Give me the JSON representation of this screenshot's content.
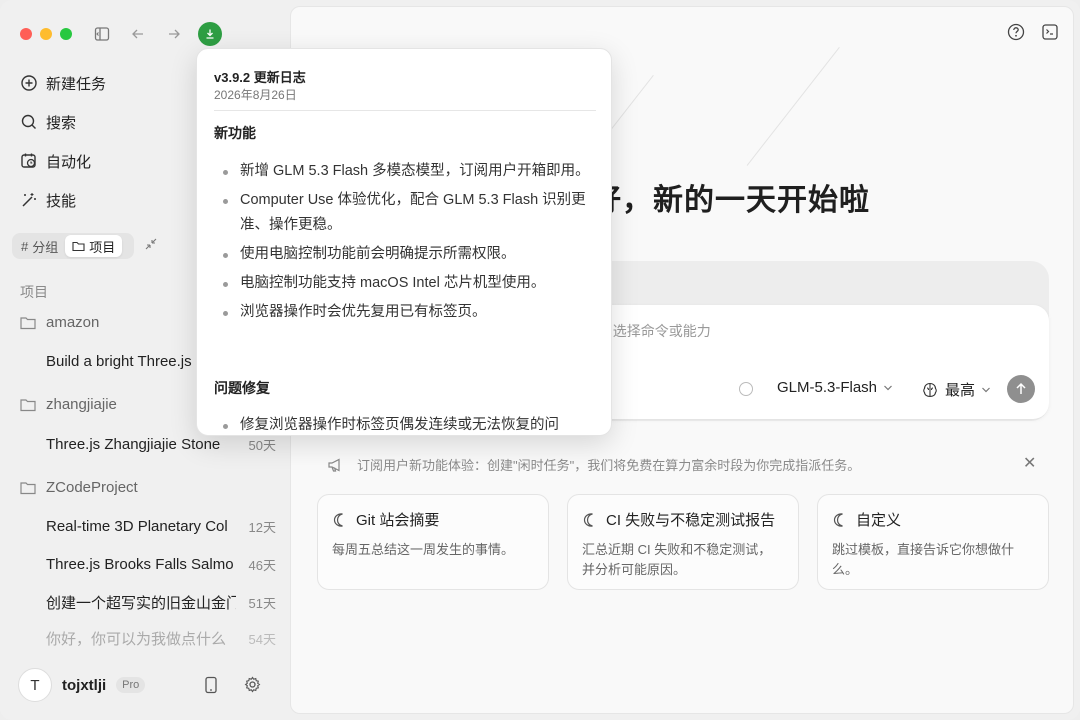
{
  "sidebar": {
    "nav": {
      "new_task": "新建任务",
      "search": "搜索",
      "automation": "自动化",
      "skills": "技能"
    },
    "segment": {
      "group": "分组",
      "project": "项目"
    },
    "section_label": "项目",
    "folders": [
      {
        "name": "amazon",
        "tasks": [
          {
            "title": "Build a bright Three.js",
            "days": ""
          }
        ]
      },
      {
        "name": "zhangjiajie",
        "tasks": [
          {
            "title": "Three.js Zhangjiajie Stone",
            "days": "50天"
          }
        ]
      },
      {
        "name": "ZCodeProject",
        "tasks": [
          {
            "title": "Real-time 3D Planetary Col",
            "days": "12天"
          },
          {
            "title": "Three.js Brooks Falls Salmo",
            "days": "46天"
          },
          {
            "title": "创建一个超写实的旧金山金门",
            "days": "51天"
          },
          {
            "title": "你好，你可以为我做点什么",
            "days": "54天"
          }
        ]
      }
    ],
    "user": {
      "initial": "T",
      "name": "tojxtlji",
      "badge": "Pro"
    }
  },
  "main": {
    "greeting": "好，新的一天开始啦",
    "composer": {
      "placeholder": "/ 选择命令或能力",
      "model": "GLM-5.3-Flash",
      "level": "最高"
    },
    "notice": "订阅用户新功能体验：创建\"闲时任务\"，我们将免费在算力富余时段为你完成指派任务。",
    "cards": [
      {
        "title": "Git 站会摘要",
        "desc": "每周五总结这一周发生的事情。"
      },
      {
        "title": "CI 失败与不稳定测试报告",
        "desc": "汇总近期 CI 失败和不稳定测试，并分析可能原因。"
      },
      {
        "title": "自定义",
        "desc": "跳过模板，直接告诉它你想做什么。"
      }
    ]
  },
  "changelog": {
    "title": "v3.9.2 更新日志",
    "date": "2026年8月26日",
    "new_heading": "新功能",
    "new_items": [
      "新增 GLM 5.3 Flash 多模态模型，订阅用户开箱即用。",
      "Computer Use 体验优化，配合 GLM 5.3 Flash 识别更准、操作更稳。",
      "使用电脑控制功能前会明确提示所需权限。",
      "电脑控制功能支持 macOS Intel 芯片机型使用。",
      "浏览器操作时会优先复用已有标签页。"
    ],
    "fix_heading": "问题修复",
    "fix_first_item": "修复浏览器操作时标签页偶发连续或无法恢复的问"
  },
  "colors": {
    "download_green": "#2e9e43",
    "send_gray": "#8f8f8f"
  }
}
